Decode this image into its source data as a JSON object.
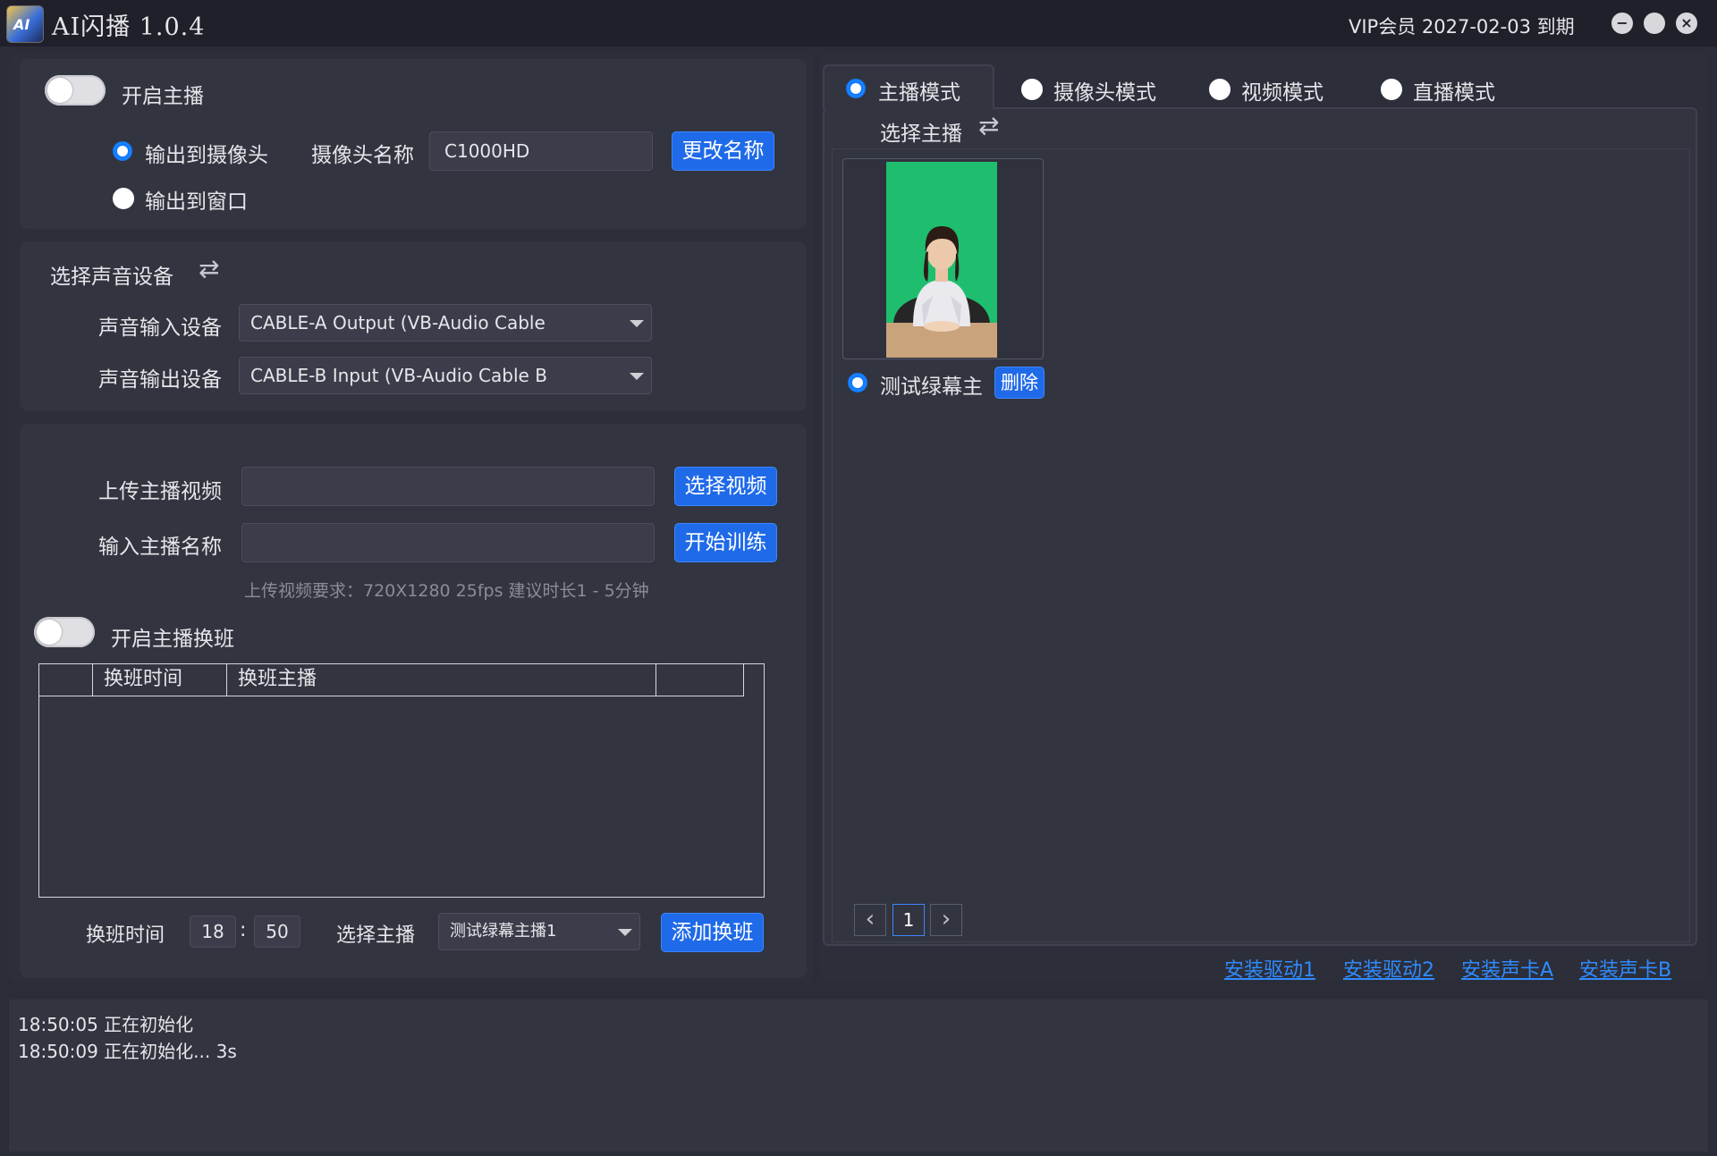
{
  "window": {
    "icon_text": "AI",
    "title": "AI闪播 1.0.4",
    "vip_text": "VIP会员 2027-02-03 到期"
  },
  "stream_panel": {
    "enable_label": "开启主播",
    "output_camera_label": "输出到摄像头",
    "output_window_label": "输出到窗口",
    "camera_name_label": "摄像头名称",
    "camera_name_value": "C1000HD",
    "rename_button": "更改名称"
  },
  "audio_panel": {
    "title": "选择声音设备",
    "input_label": "声音输入设备",
    "input_value": "CABLE-A Output (VB-Audio Cable",
    "output_label": "声音输出设备",
    "output_value": "CABLE-B Input (VB-Audio Cable B"
  },
  "upload_panel": {
    "upload_label": "上传主播视频",
    "upload_value": "",
    "select_video_button": "选择视频",
    "name_label": "输入主播名称",
    "name_value": "",
    "train_button": "开始训练",
    "hint": "上传视频要求：720X1280 25fps  建议时长1 - 5分钟",
    "shift_toggle_label": "开启主播换班",
    "table_headers": [
      "",
      "换班时间",
      "换班主播",
      ""
    ],
    "shift_time_label": "换班时间",
    "shift_hour": "18",
    "shift_minute": "50",
    "time_separator": ":",
    "select_host_label": "选择主播",
    "select_host_value": "测试绿幕主播1",
    "add_shift_button": "添加换班"
  },
  "mode_tabs": [
    {
      "label": "主播模式",
      "selected": true
    },
    {
      "label": "摄像头模式",
      "selected": false
    },
    {
      "label": "视频模式",
      "selected": false
    },
    {
      "label": "直播模式",
      "selected": false
    }
  ],
  "host_panel": {
    "title": "选择主播",
    "host_name": "测试绿幕主",
    "delete_button": "删除",
    "page_prev": "‹",
    "page_current": "1",
    "page_next": "›"
  },
  "links": [
    "安装驱动1",
    "安装驱动2",
    "安装声卡A",
    "安装声卡B"
  ],
  "log": [
    "18:50:05 正在初始化",
    "18:50:09 正在初始化... 3s"
  ],
  "colors": {
    "accent": "#1f6ae8",
    "link": "#2f8bff",
    "green_screen": "#1fbe6e"
  }
}
